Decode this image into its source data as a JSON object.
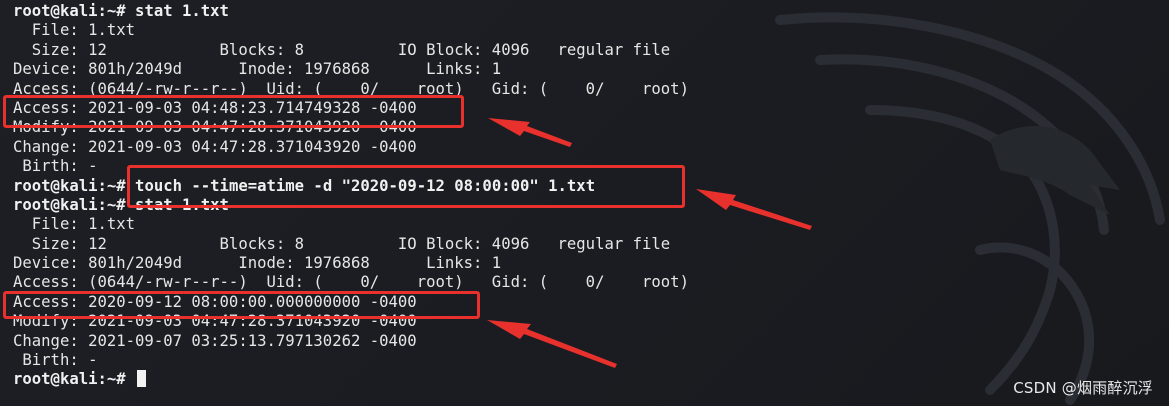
{
  "terminal": {
    "lines": [
      {
        "prompt": "root@kali:~#",
        "text": " stat 1.txt"
      },
      {
        "prompt": "",
        "text": "  File: 1.txt"
      },
      {
        "prompt": "",
        "text": "  Size: 12            Blocks: 8          IO Block: 4096   regular file"
      },
      {
        "prompt": "",
        "text": "Device: 801h/2049d      Inode: 1976868      Links: 1"
      },
      {
        "prompt": "",
        "text": "Access: (0644/-rw-r--r--)  Uid: (    0/    root)   Gid: (    0/    root)"
      },
      {
        "prompt": "",
        "text": "Access: 2021-09-03 04:48:23.714749328 -0400"
      },
      {
        "prompt": "",
        "text": "Modify: 2021-09-03 04:47:28.371043920 -0400"
      },
      {
        "prompt": "",
        "text": "Change: 2021-09-03 04:47:28.371043920 -0400"
      },
      {
        "prompt": "",
        "text": " Birth: -"
      },
      {
        "prompt": "root@kali:~#",
        "text": " touch --time=atime -d \"2020-09-12 08:00:00\" 1.txt"
      },
      {
        "prompt": "root@kali:~#",
        "text": " stat 1.txt"
      },
      {
        "prompt": "",
        "text": "  File: 1.txt"
      },
      {
        "prompt": "",
        "text": "  Size: 12            Blocks: 8          IO Block: 4096   regular file"
      },
      {
        "prompt": "",
        "text": "Device: 801h/2049d      Inode: 1976868      Links: 1"
      },
      {
        "prompt": "",
        "text": "Access: (0644/-rw-r--r--)  Uid: (    0/    root)   Gid: (    0/    root)"
      },
      {
        "prompt": "",
        "text": "Access: 2020-09-12 08:00:00.000000000 -0400"
      },
      {
        "prompt": "",
        "text": "Modify: 2021-09-03 04:47:28.371043920 -0400"
      },
      {
        "prompt": "",
        "text": "Change: 2021-09-07 03:25:13.797130262 -0400"
      },
      {
        "prompt": "",
        "text": " Birth: -"
      },
      {
        "prompt": "root@kali:~#",
        "text": " "
      }
    ]
  },
  "watermark": "CSDN @烟雨醉沉浮",
  "colors": {
    "background": "#1b1d22",
    "text": "#e6e6e6",
    "annotation": "#e8302c"
  }
}
